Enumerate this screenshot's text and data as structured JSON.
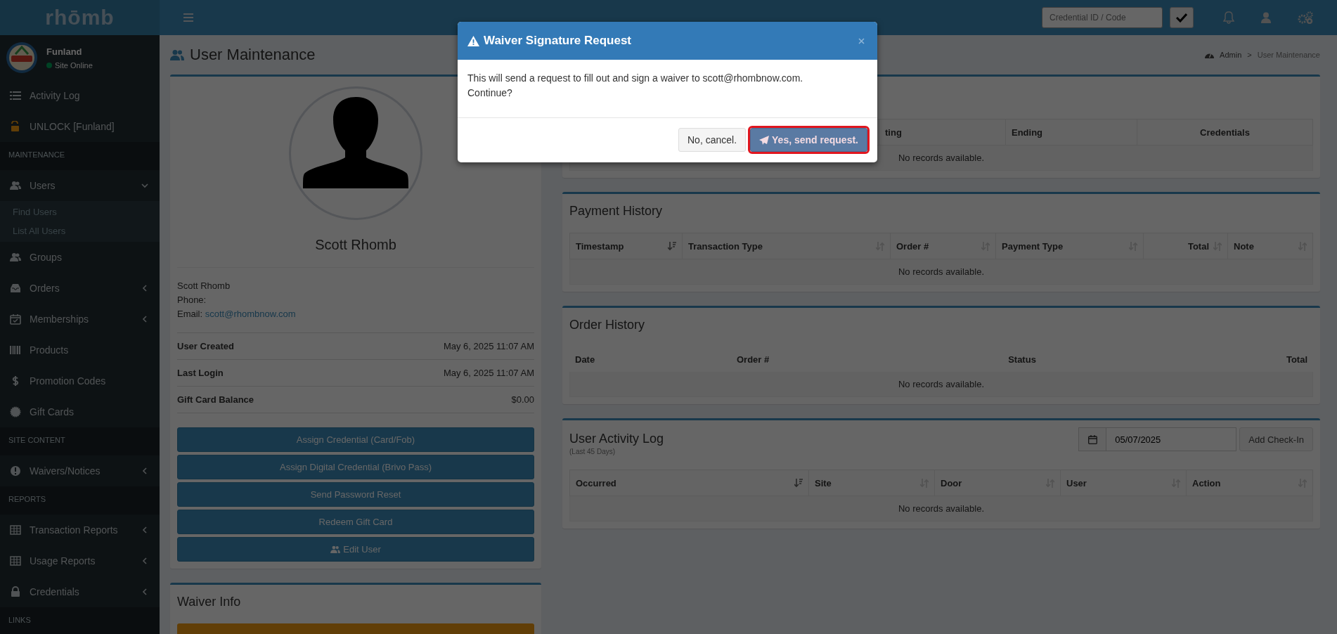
{
  "topbar": {
    "logo": "rhōmb",
    "credential_field": {
      "placeholder": "Credential ID / Code"
    }
  },
  "sidebar": {
    "site": {
      "name": "Funland",
      "status": "Site Online",
      "online": true
    },
    "items": [
      {
        "kind": "link",
        "label": "Activity Log"
      },
      {
        "kind": "link",
        "label": "UNLOCK [Funland]"
      },
      {
        "kind": "header",
        "label": "MAINTENANCE"
      },
      {
        "kind": "menu",
        "label": "Users",
        "expanded": true,
        "children": [
          {
            "label": "Find Users"
          },
          {
            "label": "List All Users"
          }
        ]
      },
      {
        "kind": "link",
        "label": "Groups"
      },
      {
        "kind": "menu",
        "label": "Orders",
        "expanded": false
      },
      {
        "kind": "menu",
        "label": "Memberships",
        "expanded": false
      },
      {
        "kind": "link",
        "label": "Products"
      },
      {
        "kind": "link",
        "label": "Promotion Codes"
      },
      {
        "kind": "link",
        "label": "Gift Cards"
      },
      {
        "kind": "header",
        "label": "SITE CONTENT"
      },
      {
        "kind": "menu",
        "label": "Waivers/Notices",
        "expanded": false
      },
      {
        "kind": "header",
        "label": "REPORTS"
      },
      {
        "kind": "menu",
        "label": "Transaction Reports",
        "expanded": false
      },
      {
        "kind": "menu",
        "label": "Usage Reports",
        "expanded": false
      },
      {
        "kind": "menu",
        "label": "Credentials",
        "expanded": false
      },
      {
        "kind": "header",
        "label": "LINKS"
      }
    ]
  },
  "page": {
    "title": "User Maintenance",
    "breadcrumb": [
      "Admin",
      "User Maintenance"
    ],
    "breadcrumb_separator": ">"
  },
  "profile": {
    "name": "Scott Rhomb",
    "contact_name": "Scott Rhomb",
    "phone_label": "Phone:",
    "email_label": "Email:",
    "email": "scott@rhombnow.com",
    "facts": [
      {
        "label": "User Created",
        "value": "May 6, 2025 11:07 AM"
      },
      {
        "label": "Last Login",
        "value": "May 6, 2025 11:07 AM"
      },
      {
        "label": "Gift Card Balance",
        "value": "$0.00"
      }
    ],
    "actions": [
      "Assign Credential (Card/Fob)",
      "Assign Digital Credential (Brivo Pass)",
      "Send Password Reset",
      "Redeem Gift Card",
      "Edit User"
    ]
  },
  "waiver_info": {
    "title": "Waiver Info"
  },
  "credentials_panel": {
    "columns": [
      "",
      "ting",
      "Ending",
      "Credentials"
    ],
    "empty": "No records available."
  },
  "payment_history": {
    "title": "Payment History",
    "columns": [
      {
        "label": "Timestamp",
        "sorted": true
      },
      {
        "label": "Transaction Type",
        "sorted": false
      },
      {
        "label": "Order #",
        "sorted": false
      },
      {
        "label": "Payment Type",
        "sorted": false
      },
      {
        "label": "Total",
        "sorted": false
      },
      {
        "label": "Note",
        "sorted": false
      }
    ],
    "empty": "No records available."
  },
  "order_history": {
    "title": "Order History",
    "columns": [
      {
        "label": "Date"
      },
      {
        "label": "Order #"
      },
      {
        "label": "Status"
      },
      {
        "label": "Total"
      }
    ],
    "empty": "No records available."
  },
  "activity_log": {
    "title": "User Activity Log",
    "subtitle": "(Last 45 Days)",
    "date": "05/07/2025",
    "add_button": "Add Check-In",
    "columns": [
      {
        "label": "Occurred",
        "sorted": true
      },
      {
        "label": "Site",
        "sorted": false
      },
      {
        "label": "Door",
        "sorted": false
      },
      {
        "label": "User",
        "sorted": false
      },
      {
        "label": "Action",
        "sorted": false
      }
    ],
    "empty": "No records available."
  },
  "modal": {
    "title": "Waiver Signature Request",
    "message": [
      "This will send a request to fill out and sign a waiver to scott@rhombnow.com.",
      "Continue?"
    ],
    "buttons": [
      {
        "label": "No, cancel.",
        "kind": "default",
        "highlighted": false
      },
      {
        "label": "Yes, send request.",
        "kind": "primary",
        "highlighted": true
      }
    ]
  }
}
